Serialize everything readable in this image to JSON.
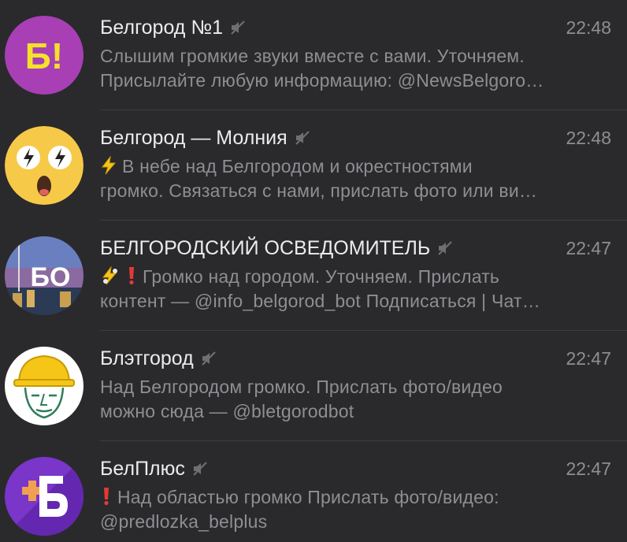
{
  "chats": [
    {
      "name": "Белгород №1",
      "time": "22:48",
      "line1": "Слышим громкие звуки вместе с вами.   Уточняем.",
      "line2": "Присылайте любую информацию: @NewsBelgoro…",
      "avatar_text": "Б!"
    },
    {
      "name": "Белгород — Молния",
      "time": "22:48",
      "line1": "В небе над Белгородом и окрестностями",
      "line2": "громко.  Связаться с нами, прислать фото или ви…"
    },
    {
      "name": "БЕЛГОРОДСКИЙ ОСВЕДОМИТЕЛЬ",
      "time": "22:47",
      "line1": "Громко над городом. Уточняем.  Прислать",
      "line2": "контент — @info_belgorod_bot  Подписаться | Чат…",
      "avatar_text": "БО"
    },
    {
      "name": "Блэтгород",
      "time": "22:47",
      "line1": "Над Белгородом громко.  Прислать фото/видео",
      "line2": "можно сюда — @bletgorodbot"
    },
    {
      "name": "БелПлюс",
      "time": "22:47",
      "line1": "Над областью громко  Прислать фото/видео:",
      "line2": "@predlozka_belplus"
    }
  ],
  "colors": {
    "background": "#2a2a2c",
    "name": "#ececec",
    "secondary": "#8e8e93",
    "avatar1": "#a83fb5",
    "avatar1_text": "#f5e12a",
    "avatar2": "#f7c948",
    "avatar5": "#7a35c9"
  },
  "icons": {
    "mute": "muted-speaker-icon",
    "lightning": "lightning-emoji-icon",
    "exclamation": "red-exclamation-icon"
  }
}
